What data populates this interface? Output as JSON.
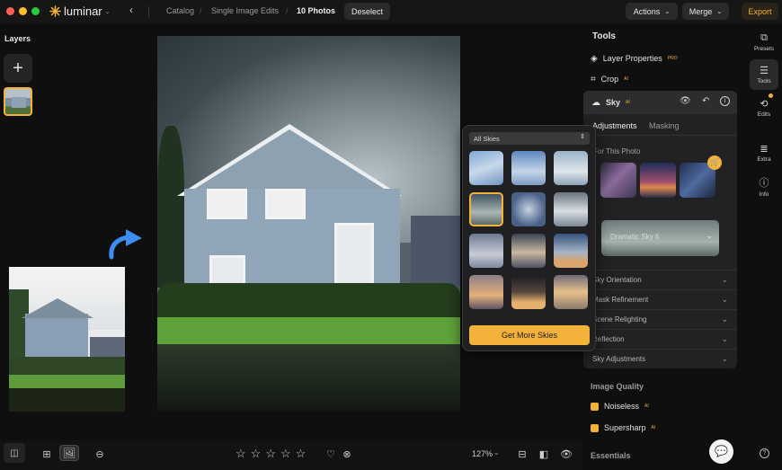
{
  "window": {
    "app_name": "luminar"
  },
  "breadcrumb": {
    "items": [
      "Catalog",
      "Single Image Edits",
      "10 Photos"
    ]
  },
  "toolbar": {
    "deselect": "Deselect",
    "actions": "Actions",
    "merge": "Merge",
    "export": "Export"
  },
  "layers": {
    "title": "Layers"
  },
  "tools_panel": {
    "title": "Tools",
    "items": [
      {
        "label": "Layer Properties",
        "badge": "PRO"
      },
      {
        "label": "Crop",
        "badge": "AI"
      }
    ],
    "sky": {
      "title": "Sky",
      "badge": "AI",
      "tabs": [
        "Adjustments",
        "Masking"
      ],
      "for_this_photo": "For This Photo",
      "selected_sky": "Dramatic Sky 6",
      "sections": [
        "Sky Orientation",
        "Mask Refinement",
        "Scene Relighting",
        "Reflection",
        "Sky Adjustments"
      ]
    },
    "image_quality": {
      "title": "Image Quality",
      "items": [
        {
          "label": "Noiseless",
          "badge": "AI"
        },
        {
          "label": "Supersharp",
          "badge": "AI"
        }
      ]
    },
    "essentials": {
      "title": "Essentials"
    }
  },
  "sky_popup": {
    "filter": "All Skies",
    "cta": "Get More Skies"
  },
  "side_nav": {
    "items": [
      {
        "label": "Presets",
        "icon": "presets-icon"
      },
      {
        "label": "Tools",
        "icon": "sliders-icon"
      },
      {
        "label": "Edits",
        "icon": "history-icon"
      },
      {
        "label": "Extra",
        "icon": "list-icon"
      },
      {
        "label": "Info",
        "icon": "info-icon"
      }
    ]
  },
  "bottom_bar": {
    "zoom": "127%",
    "rating": 0
  },
  "colors": {
    "accent": "#f3b23a",
    "background": "#0f0f10",
    "panel": "#222224"
  }
}
